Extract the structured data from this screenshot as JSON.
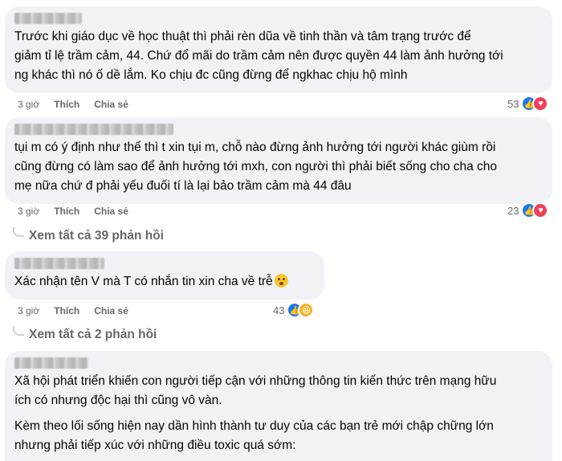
{
  "comments": [
    {
      "lines": [
        "Trước khi giáo dục về học thuật thì phải rèn dũa về tinh thần và tâm trạng trước để",
        "giảm tỉ lệ trầm cảm, 44. Chứ đổ mãi do trầm cảm nên được quyền 44 làm ảnh hưởng tới",
        "ng khác thì nó ố dề lắm. Ko chịu đc cũng đừng để ngkhac chịu hộ mình"
      ],
      "time": "3 giờ",
      "like_label": "Thích",
      "share_label": "Chia sẻ",
      "reaction_count": "53",
      "reactions": [
        "like-icon",
        "love-icon"
      ]
    },
    {
      "lines": [
        "tụi m có ý định như thế thì t xin tụi m, chỗ nào đừng ảnh hưởng tới người khác giùm rồi",
        "cũng đừng có làm sao để ảnh hưởng tới mxh, con người thì phải biết sống cho cha cho",
        "mẹ nữa chứ đ phải yếu đuối tí là lại bảo trầm cảm mà 44 đâu"
      ],
      "time": "3 giờ",
      "like_label": "Thích",
      "share_label": "Chia sẻ",
      "reaction_count": "23",
      "reactions": [
        "like-icon",
        "love-icon"
      ],
      "replies_label": "Xem tất cả 39 phản hồi"
    },
    {
      "lines": [
        "Xác nhận tên V mà T có nhắn tin xin cha về trễ"
      ],
      "time": "3 giờ",
      "like_label": "Thích",
      "share_label": "Chia sẻ",
      "reaction_count": "43",
      "reactions": [
        "like-icon",
        "haha-icon"
      ],
      "replies_label": "Xem tất cả 2 phản hồi"
    },
    {
      "lines": [
        "Xã hội phát triển khiến con người tiếp cận với những thông tin kiến thức trên mạng hữu",
        "ích có nhưng độc hại thì cũng vô vàn."
      ],
      "lines2": [
        "Kèm theo lối sống hiện nay dần hình thành tư duy của các bạn trẻ mới chập chững lớn",
        "nhưng phải tiếp xúc với những điều toxic quá sớm:"
      ]
    }
  ]
}
